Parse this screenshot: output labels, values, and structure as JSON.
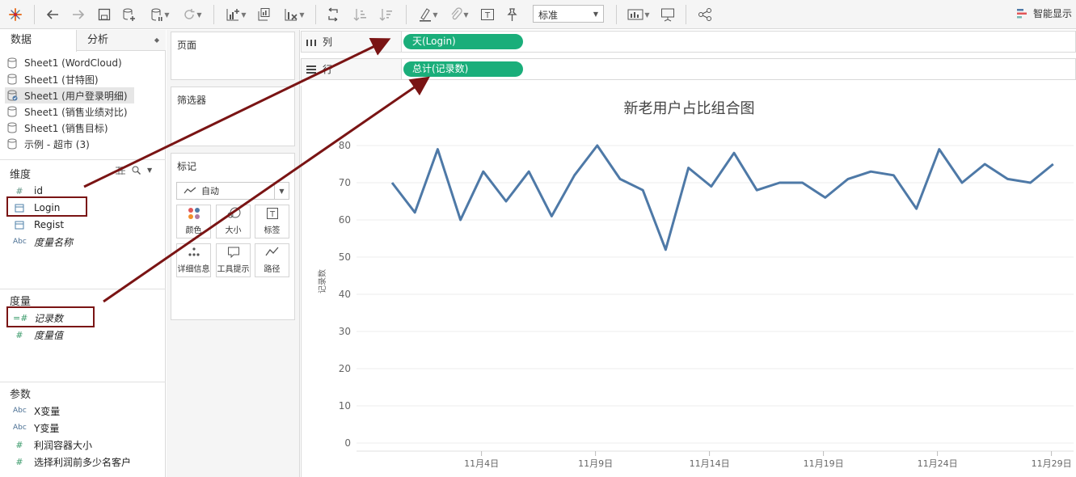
{
  "toolbar": {
    "std_select_value": "标准",
    "smart_show_label": "智能显示"
  },
  "left_pane": {
    "tabs": [
      {
        "label": "数据"
      },
      {
        "label": "分析"
      }
    ],
    "data_sources": [
      {
        "label": "Sheet1 (WordCloud)"
      },
      {
        "label": "Sheet1 (甘特图)"
      },
      {
        "label": "Sheet1 (用户登录明细)",
        "selected": true
      },
      {
        "label": "Sheet1 (销售业绩对比)"
      },
      {
        "label": "Sheet1 (销售目标)"
      },
      {
        "label": "示例 - 超市 (3)"
      }
    ],
    "dimensions_title": "维度",
    "dimensions": [
      {
        "label": "id",
        "icon": "number-icon"
      },
      {
        "label": "Login",
        "icon": "calendar-icon"
      },
      {
        "label": "Regist",
        "icon": "calendar-icon"
      },
      {
        "label": "度量名称",
        "icon": "abc-icon"
      }
    ],
    "measures_title": "度量",
    "measures": [
      {
        "label": "记录数",
        "icon": "number-icon"
      },
      {
        "label": "度量值",
        "icon": "number-icon"
      }
    ],
    "parameters_title": "参数",
    "parameters": [
      {
        "label": "X变量",
        "icon": "abc-icon"
      },
      {
        "label": "Y变量",
        "icon": "abc-icon"
      },
      {
        "label": "利润容器大小",
        "icon": "number-icon"
      },
      {
        "label": "选择利润前多少名客户",
        "icon": "number-icon"
      }
    ]
  },
  "cards": {
    "pages": "页面",
    "filters": "筛选器",
    "marks": "标记",
    "marks_type": "自动",
    "mark_buttons": [
      {
        "label": "颜色",
        "icon": "color-icon"
      },
      {
        "label": "大小",
        "icon": "size-icon"
      },
      {
        "label": "标签",
        "icon": "label-icon"
      },
      {
        "label": "详细信息",
        "icon": "detail-icon"
      },
      {
        "label": "工具提示",
        "icon": "tooltip-icon"
      },
      {
        "label": "路径",
        "icon": "path-icon"
      }
    ]
  },
  "shelves": {
    "columns_label": "列",
    "columns_pill": "天(Login)",
    "rows_label": "行",
    "rows_pill": "总计(记录数)"
  },
  "colors": {
    "pill": "#1aae7a",
    "line": "#4e79a7",
    "annotation": "#7a1414"
  },
  "chart_data": {
    "type": "line",
    "title": "新老用户占比组合图",
    "ylabel": "记录数",
    "ylim": [
      0,
      80
    ],
    "yticks": [
      0,
      10,
      20,
      30,
      40,
      50,
      60,
      70,
      80
    ],
    "xticks": [
      "11月4日",
      "11月9日",
      "11月14日",
      "11月19日",
      "11月24日",
      "11月29日"
    ],
    "x": [
      1,
      2,
      3,
      4,
      5,
      6,
      7,
      8,
      9,
      10,
      11,
      12,
      13,
      14,
      15,
      16,
      17,
      18,
      19,
      20,
      21,
      22,
      23,
      24,
      25,
      26,
      27,
      28,
      29,
      30
    ],
    "values": [
      70,
      62,
      79,
      60,
      73,
      65,
      73,
      61,
      72,
      80,
      71,
      68,
      52,
      74,
      69,
      78,
      68,
      70,
      70,
      66,
      71,
      73,
      72,
      63,
      79,
      70,
      75,
      71,
      70,
      75
    ]
  }
}
